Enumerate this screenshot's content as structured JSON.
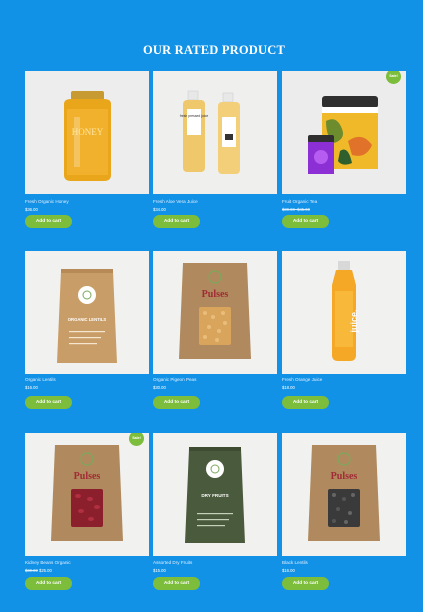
{
  "section": {
    "title": "OUR RATED PRODUCT"
  },
  "products": [
    {
      "name": "Fresh Organic Honey",
      "price": "$36.00",
      "old_price": "",
      "sale": "",
      "button": "Add to cart"
    },
    {
      "name": "Fresh Aloe Vera Juice",
      "price": "$34.00",
      "old_price": "",
      "sale": "",
      "button": "Add to cart"
    },
    {
      "name": "Fruit Organic Tea",
      "price": "$35.00",
      "old_price": "$30.00–$45.00",
      "sale": "Sale!",
      "button": "Add to cart"
    },
    {
      "name": "Organic Lentils",
      "price": "$16.00",
      "old_price": "",
      "sale": "",
      "button": "Add to cart"
    },
    {
      "name": "Organic Pigeon Peas",
      "price": "$30.00",
      "old_price": "",
      "sale": "",
      "button": "Add to cart"
    },
    {
      "name": "Fresh Orange Juice",
      "price": "$18.00",
      "old_price": "",
      "sale": "",
      "button": "Add to cart"
    },
    {
      "name": "Kidney Beans Organic",
      "price": "$25.00",
      "old_price": "$30.00",
      "sale": "Sale!",
      "button": "Add to cart"
    },
    {
      "name": "Assorted Dry Fruits",
      "price": "$15.00",
      "old_price": "",
      "sale": "",
      "button": "Add to cart"
    },
    {
      "name": "Black Lentils",
      "price": "$16.00",
      "old_price": "",
      "sale": "",
      "button": "Add to cart"
    }
  ],
  "packaging": {
    "honey_label": "HONEY",
    "juice_label": "fresh pressed juice",
    "lentils_label": "ORGANIC LENTILS",
    "pulses_label": "Pulses",
    "dry_fruits_label": "DRY FRUITS",
    "orange_label": "juice."
  },
  "colors": {
    "background": "#1292e6",
    "accent": "#7cbd3b",
    "text": "#ffffff"
  }
}
